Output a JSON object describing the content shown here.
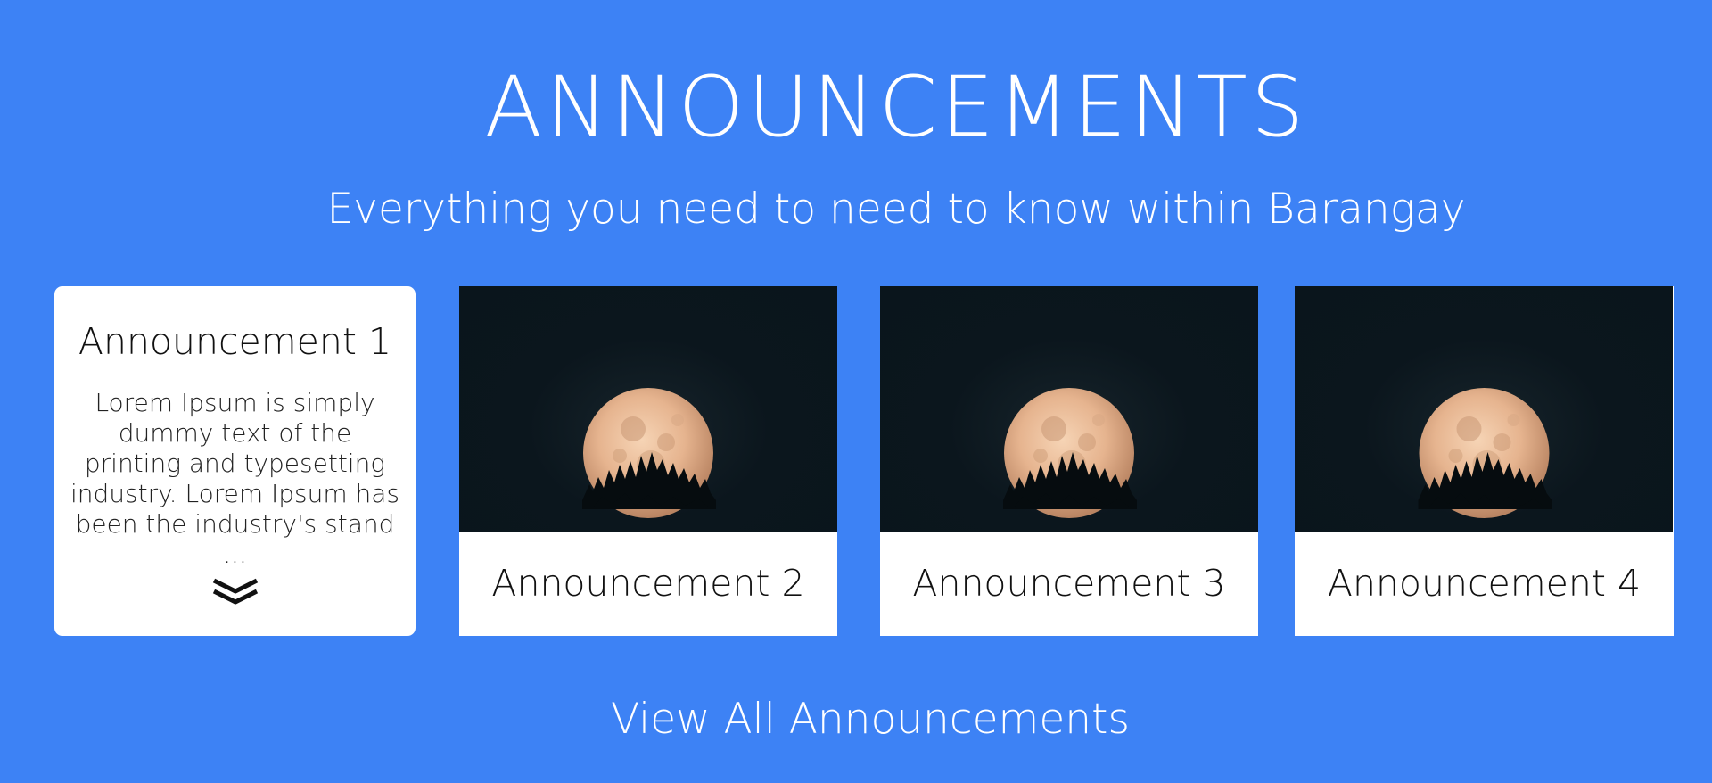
{
  "section": {
    "title": "ANNOUNCEMENTS",
    "subtitle": "Everything you need to need to know within Barangay"
  },
  "cards": [
    {
      "title": "Announcement 1",
      "excerpt": "Lorem Ipsum is simply dummy text of the printing and typesetting industry. Lorem Ipsum has been the industry's stand ...",
      "expand_icon": "double-chevron-down-icon"
    },
    {
      "title": "Announcement 2",
      "image": "moon-over-trees-image"
    },
    {
      "title": "Announcement 3",
      "image": "moon-over-trees-image"
    },
    {
      "title": "Announcement 4",
      "image": "moon-over-trees-image"
    }
  ],
  "footer": {
    "view_all_label": "View All Announcements"
  },
  "colors": {
    "background": "#3d82f5",
    "card": "#ffffff",
    "image_sky": "#0a151c",
    "moon": "#e8b895"
  }
}
